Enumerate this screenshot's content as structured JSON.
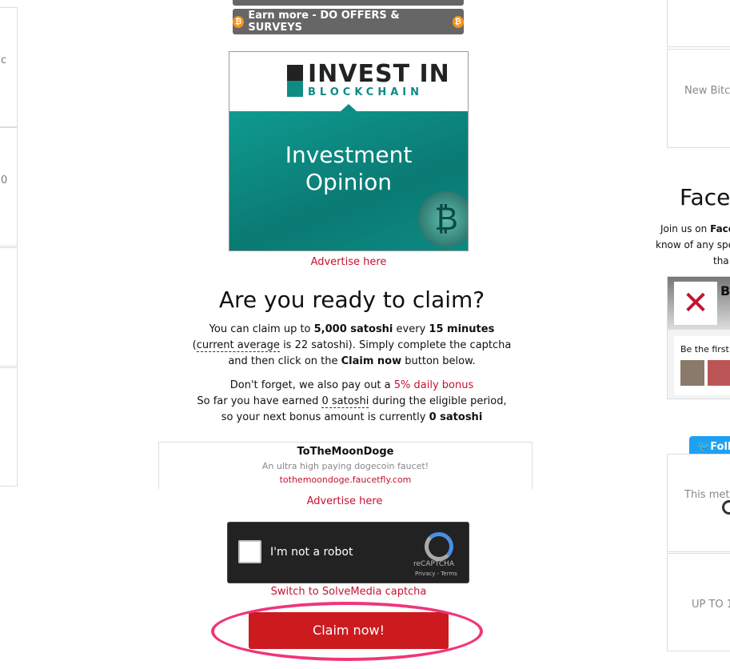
{
  "left_boxes": [
    "c",
    "0",
    "",
    ""
  ],
  "earn_more_button": "Earn more - DO OFFERS & SURVEYS",
  "ad_banner": {
    "logo_top": "INVEST IN",
    "logo_bottom": "BLOCKCHAIN",
    "headline_1": "Investment",
    "headline_2": "Opinion"
  },
  "advertise_here": "Advertise here",
  "claim": {
    "heading": "Are you ready to claim?",
    "p1_a": "You can claim up to ",
    "p1_amount": "5,000 satoshi",
    "p1_b": " every ",
    "p1_interval": "15 minutes",
    "p1_c": "(",
    "p1_avg_label": "current average",
    "p1_d": " is 22 satoshi). Simply complete the captcha and then click on the ",
    "p1_btn": "Claim now",
    "p1_e": " button below.",
    "p2_a": "Don't forget, we also pay out a ",
    "p2_link": "5% daily bonus",
    "p2_b": "So far you have earned ",
    "p2_earned": "0 satoshi",
    "p2_c": " during the eligible period, so your next bonus amount is currently ",
    "p2_next": "0 satoshi"
  },
  "text_ad": {
    "title": "ToTheMoonDoge",
    "desc": "An ultra high paying dogecoin faucet!",
    "url": "tothemoondoge.faucetfly.com"
  },
  "recaptcha": {
    "label": "I'm not a robot",
    "brand": "reCAPTCHA",
    "privacy": "Privacy",
    "terms": "Terms"
  },
  "switch_captcha": "Switch to SolveMedia captcha",
  "claim_button": "Claim now!",
  "right": {
    "box2_text": "New Bitc",
    "facebook_heading": "Faceb",
    "facebook_text_1a": "Join us on ",
    "facebook_text_1b": "Face",
    "facebook_text_2": "know of any spe",
    "facebook_text_3": "tha",
    "fb_widget_title": "B",
    "fb_widget_first": "Be the first",
    "twitter_button": "Foll",
    "box3_text": "This meth",
    "box4_text": "UP TO 1"
  },
  "colors": {
    "claim_red": "#cc1b1f",
    "highlight_pink": "#f0357a",
    "teal": "#0d8c84",
    "link_red": "#c4122f"
  }
}
